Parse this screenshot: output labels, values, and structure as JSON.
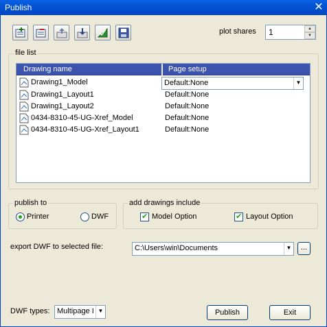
{
  "window": {
    "title": "Publish",
    "close_glyph": "✕"
  },
  "toolbar": {
    "buttons": [
      {
        "icon": "add-drawing-icon"
      },
      {
        "icon": "remove-drawing-icon"
      },
      {
        "icon": "move-up-icon"
      },
      {
        "icon": "move-down-icon"
      },
      {
        "icon": "publish-settings-icon"
      },
      {
        "icon": "save-icon"
      }
    ]
  },
  "plot_shares": {
    "label": "plot shares",
    "value": "1",
    "up": "▲",
    "down": "▼"
  },
  "file_list": {
    "group_label": "file list",
    "columns": [
      "Drawing name",
      "Page setup"
    ],
    "rows": [
      {
        "name": "Drawing1_Model",
        "page": "Default:None",
        "selected": true
      },
      {
        "name": "Drawing1_Layout1",
        "page": "Default:None"
      },
      {
        "name": "Drawing1_Layout2",
        "page": "Default:None"
      },
      {
        "name": "0434-8310-45-UG-Xref_Model",
        "page": "Default:None"
      },
      {
        "name": "0434-8310-45-UG-Xref_Layout1",
        "page": "Default:None"
      }
    ],
    "dropdown_arrow": "▼"
  },
  "publish_to": {
    "group_label": "publish to",
    "options": [
      {
        "label": "Printer",
        "selected": true
      },
      {
        "label": "DWF",
        "selected": false
      }
    ]
  },
  "add_drawings": {
    "group_label": "add drawings include",
    "options": [
      {
        "label": "Model Option",
        "checked": true
      },
      {
        "label": "Layout Option",
        "checked": true
      }
    ]
  },
  "export": {
    "label": "export DWF to selected file:",
    "path": "C:\\Users\\win\\Documents",
    "browse_label": "..."
  },
  "dwf_types": {
    "label": "DWF types:",
    "value": "Multipage I"
  },
  "buttons": {
    "publish": "Publish",
    "exit": "Exit"
  },
  "colors": {
    "title_bar": "#0453d2",
    "list_header": "#3c54ad",
    "dialog_bg": "#ece9d8"
  }
}
